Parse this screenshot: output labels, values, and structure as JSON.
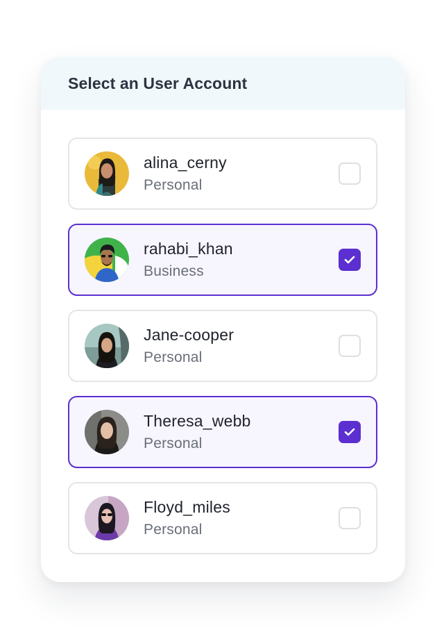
{
  "title": "Select an User Account",
  "colors": {
    "accent": "#5b2fd0",
    "selected_bg": "#f7f5fe",
    "header_bg": "#f1f8fc",
    "border": "#e3e5e8"
  },
  "accounts": [
    {
      "name": "alina_cerny",
      "type": "Personal",
      "checked": false,
      "avatar": "avatar-alina-icon"
    },
    {
      "name": "rahabi_khan",
      "type": "Business",
      "checked": true,
      "avatar": "avatar-rahabi-icon"
    },
    {
      "name": "Jane-cooper",
      "type": "Personal",
      "checked": false,
      "avatar": "avatar-jane-icon"
    },
    {
      "name": "Theresa_webb",
      "type": "Personal",
      "checked": true,
      "avatar": "avatar-theresa-icon"
    },
    {
      "name": "Floyd_miles",
      "type": "Personal",
      "checked": false,
      "avatar": "avatar-floyd-icon"
    }
  ]
}
